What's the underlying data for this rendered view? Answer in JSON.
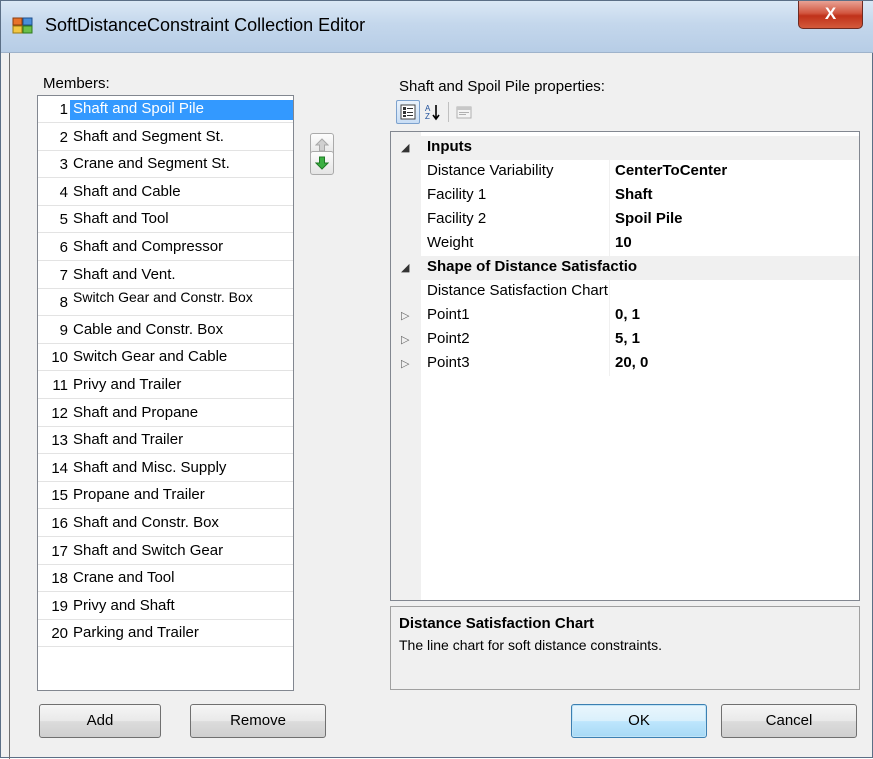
{
  "window": {
    "title": "SoftDistanceConstraint Collection Editor",
    "close_glyph": "X"
  },
  "members": {
    "label": "Members:",
    "items": [
      {
        "num": "1",
        "name": "Shaft and Spoil Pile"
      },
      {
        "num": "2",
        "name": "Shaft and Segment St."
      },
      {
        "num": "3",
        "name": "Crane and Segment St."
      },
      {
        "num": "4",
        "name": "Shaft and Cable"
      },
      {
        "num": "5",
        "name": "Shaft and Tool"
      },
      {
        "num": "6",
        "name": "Shaft and Compressor"
      },
      {
        "num": "7",
        "name": "Shaft and Vent."
      },
      {
        "num": "8",
        "name": "Switch Gear and Constr. Box"
      },
      {
        "num": "9",
        "name": "Cable and Constr. Box"
      },
      {
        "num": "10",
        "name": "Switch Gear and Cable"
      },
      {
        "num": "11",
        "name": "Privy and Trailer"
      },
      {
        "num": "12",
        "name": "Shaft and Propane"
      },
      {
        "num": "13",
        "name": "Shaft and Trailer"
      },
      {
        "num": "14",
        "name": "Shaft and Misc. Supply"
      },
      {
        "num": "15",
        "name": "Propane and Trailer"
      },
      {
        "num": "16",
        "name": "Shaft and Constr. Box"
      },
      {
        "num": "17",
        "name": "Shaft and Switch Gear"
      },
      {
        "num": "18",
        "name": "Crane and Tool"
      },
      {
        "num": "19",
        "name": "Privy and Shaft"
      },
      {
        "num": "20",
        "name": "Parking and Trailer"
      }
    ],
    "selected_index": 0,
    "move_up_icon": "arrow-up-icon",
    "move_down_icon": "arrow-down-icon"
  },
  "properties": {
    "label": "Shaft and Spoil Pile properties:",
    "toolbar_icons": [
      "categorized-icon",
      "alphabetical-icon",
      "property-pages-icon"
    ],
    "categories": [
      {
        "name": "Inputs",
        "rows": [
          {
            "name": "Distance Variability",
            "value": "CenterToCenter"
          },
          {
            "name": "Facility 1",
            "value": "Shaft"
          },
          {
            "name": "Facility 2",
            "value": "Spoil Pile"
          },
          {
            "name": "Weight",
            "value": "10"
          }
        ]
      },
      {
        "name": "Shape of Distance Satisfaction",
        "rows": [
          {
            "name": "Distance Satisfaction Chart",
            "value": ""
          },
          {
            "name": "Point1",
            "value": "0, 1"
          },
          {
            "name": "Point2",
            "value": "5, 1"
          },
          {
            "name": "Point3",
            "value": "20, 0"
          }
        ]
      }
    ]
  },
  "help": {
    "title": "Distance Satisfaction Chart",
    "description": "The line chart for soft distance constraints."
  },
  "buttons": {
    "add": "Add",
    "remove": "Remove",
    "ok": "OK",
    "cancel": "Cancel"
  },
  "colors": {
    "selection": "#3399ff",
    "move_down_green": "#3cb043",
    "close_red": "#c0321a"
  }
}
